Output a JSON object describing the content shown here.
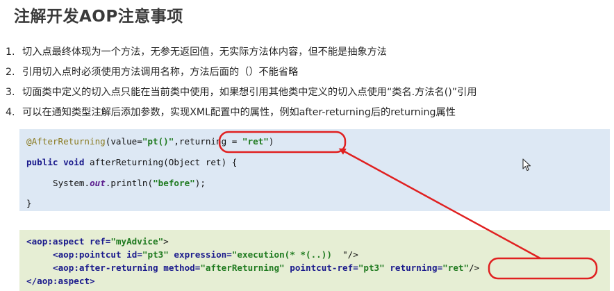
{
  "title": "注解开发AOP注意事项",
  "notes": [
    {
      "num": "1.",
      "text": "切入点最终体现为一个方法，无参无返回值，无实际方法体内容，但不能是抽象方法"
    },
    {
      "num": "2.",
      "text": "引用切入点时必须使用方法调用名称，方法后面的（）不能省略"
    },
    {
      "num": "3.",
      "text": "切面类中定义的切入点只能在当前类中使用，如果想引用其他类中定义的切入点使用“类名.方法名()”引用"
    },
    {
      "num": "4.",
      "text": "可以在通知类型注解后添加参数，实现XML配置中的属性，例如after-returning后的returning属性"
    }
  ],
  "java_code": {
    "annotation": "@AfterReturning",
    "open_paren": "(value=",
    "value_str": "\"pt()\"",
    "comma": ",",
    "returning_key": "returning = ",
    "returning_val": "\"ret\"",
    "close_paren": ")",
    "kw_public": "public",
    "kw_void": "void",
    "method_sig": " afterReturning(Object ret) {",
    "system": "System.",
    "out": "out",
    "println_open": ".println(",
    "before_str": "\"before\"",
    "println_close": ");",
    "close_brace": "}"
  },
  "xml_code": {
    "aspect_open": "<aop:aspect",
    "ref_attr": " ref=",
    "ref_val": "\"myAdvice\"",
    "gt": ">",
    "pointcut_tag": "<aop:pointcut",
    "id_attr": " id=",
    "id_val": "\"pt3\"",
    "expr_attr": " expression=",
    "expr_val": "\"execution(* *(..))",
    "expr_tail": "  \"/>",
    "after_tag": "<aop:after-returning",
    "method_attr": " method=",
    "method_val": "\"afterReturning\"",
    "pcref_attr": " pointcut-ref=",
    "pcref_val": "\"pt3\"",
    "ret_attr": "returning=",
    "ret_val": "\"ret\"",
    "self_close": "/>",
    "aspect_close": "</aop:aspect>"
  },
  "colors": {
    "highlight": "#e02020",
    "java_bg": "#dde8f4",
    "xml_bg": "#e6eed4"
  },
  "icons": {
    "cursor": "mouse-pointer-icon"
  }
}
